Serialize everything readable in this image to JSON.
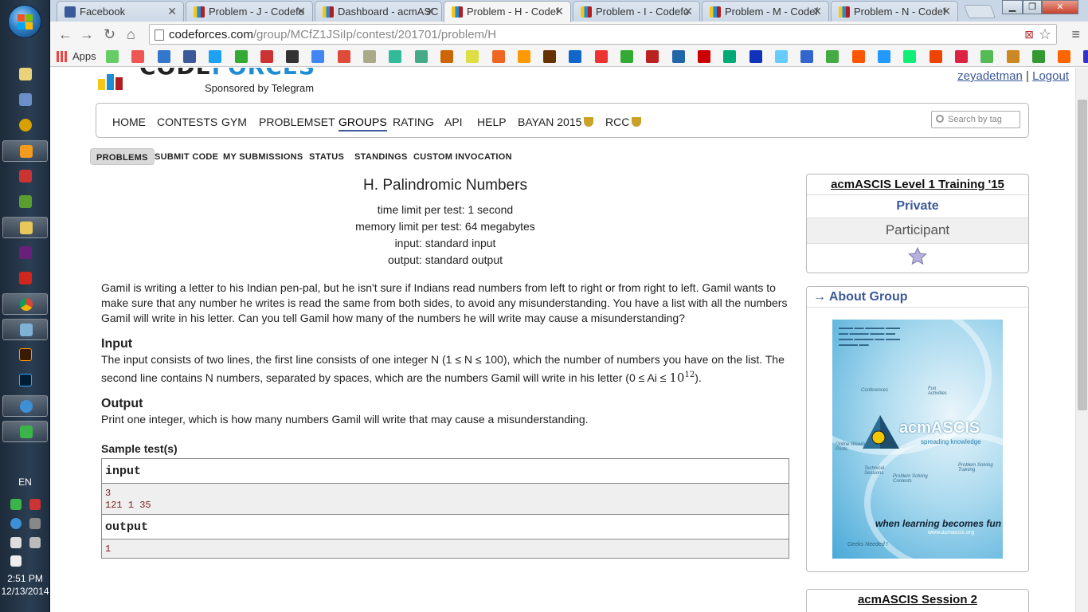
{
  "os": {
    "language": "EN",
    "time": "2:51 PM",
    "date": "12/13/2014"
  },
  "browser": {
    "tabs": [
      {
        "label": "Facebook",
        "icon": "facebook-icon",
        "active": false
      },
      {
        "label": "Problem - J - Codefo",
        "icon": "codeforces-icon",
        "active": false
      },
      {
        "label": "Dashboard - acmASC",
        "icon": "codeforces-icon",
        "active": false
      },
      {
        "label": "Problem - H - Codef",
        "icon": "codeforces-icon",
        "active": true
      },
      {
        "label": "Problem - I - Codefo",
        "icon": "codeforces-icon",
        "active": false
      },
      {
        "label": "Problem - M - Codef",
        "icon": "codeforces-icon",
        "active": false
      },
      {
        "label": "Problem - N - Codef",
        "icon": "codeforces-icon",
        "active": false
      }
    ],
    "url_host": "codeforces.com",
    "url_path": "/group/MCfZ1JSiIp/contest/201701/problem/H",
    "apps_label": "Apps"
  },
  "header": {
    "logo_part1": "CODE",
    "logo_part2": "FORCES",
    "sponsor": "Sponsored by Telegram",
    "username": "zeyadetman",
    "separator": "|",
    "logout": "Logout"
  },
  "menu": {
    "items": [
      "HOME",
      "CONTESTS",
      "GYM",
      "PROBLEMSET",
      "GROUPS",
      "RATING",
      "API",
      "HELP",
      "BAYAN 2015",
      "RCC"
    ],
    "current": "GROUPS",
    "search_placeholder": "Search by tag"
  },
  "submenu": {
    "items": [
      "PROBLEMS",
      "SUBMIT CODE",
      "MY SUBMISSIONS",
      "STATUS",
      "STANDINGS",
      "CUSTOM INVOCATION"
    ],
    "current": "PROBLEMS"
  },
  "problem": {
    "title": "H. Palindromic Numbers",
    "time_limit": "time limit per test: 1 second",
    "memory_limit": "memory limit per test: 64 megabytes",
    "input_file": "input: standard input",
    "output_file": "output: standard output",
    "legend": "Gamil is writing a letter to his Indian pen-pal, but he isn't sure if Indians read numbers from left to right or from right to left. Gamil wants to make sure that any number he writes is read the same from both sides, to avoid any misunderstanding. You have a list with all the numbers Gamil will write in his letter. Can you tell Gamil how many of the numbers he will write may cause a misunderstanding?",
    "input_title": "Input",
    "input_spec_1": "The input consists of two lines, the first line consists of one integer N (1 ≤ N ≤ 100), which the number of numbers you have on the list. The second line contains N numbers, separated by spaces, which are the numbers Gamil will write in his letter (0 ≤ Ai ≤ ",
    "input_spec_base": "10",
    "input_spec_exp": "12",
    "input_spec_2": ").",
    "output_title": "Output",
    "output_spec": "Print one integer, which is how many numbers Gamil will write that may cause a misunderstanding.",
    "samples_title": "Sample test(s)",
    "sample_input_label": "input",
    "sample_input": "3\n121 1 35",
    "sample_output_label": "output",
    "sample_output": "1"
  },
  "sidebar": {
    "contest_title": "acmASCIS Level 1 Training '15",
    "visibility": "Private",
    "role": "Participant",
    "about_title": "→ About Group",
    "poster_brand": "acmASCIS",
    "poster_tagline": "spreading knowledge",
    "poster_slogan": "when learning becomes fun",
    "poster_url": "www.acmascis.org",
    "poster_geeks": "Geeks Needed !",
    "poster_nodes": [
      "Conferences",
      "Fun Activities",
      "Online Weekly Posts",
      "Technical Sessions",
      "Problem Solving Contests",
      "Problem Solving Training"
    ],
    "next_box_title": "acmASCIS Session 2"
  },
  "colors": {
    "link": "#3b5998",
    "cf_yellow": "#f5c518",
    "cf_blue": "#1f8dd6",
    "cf_red": "#b11e22",
    "sample_text": "#7a1e1e"
  }
}
